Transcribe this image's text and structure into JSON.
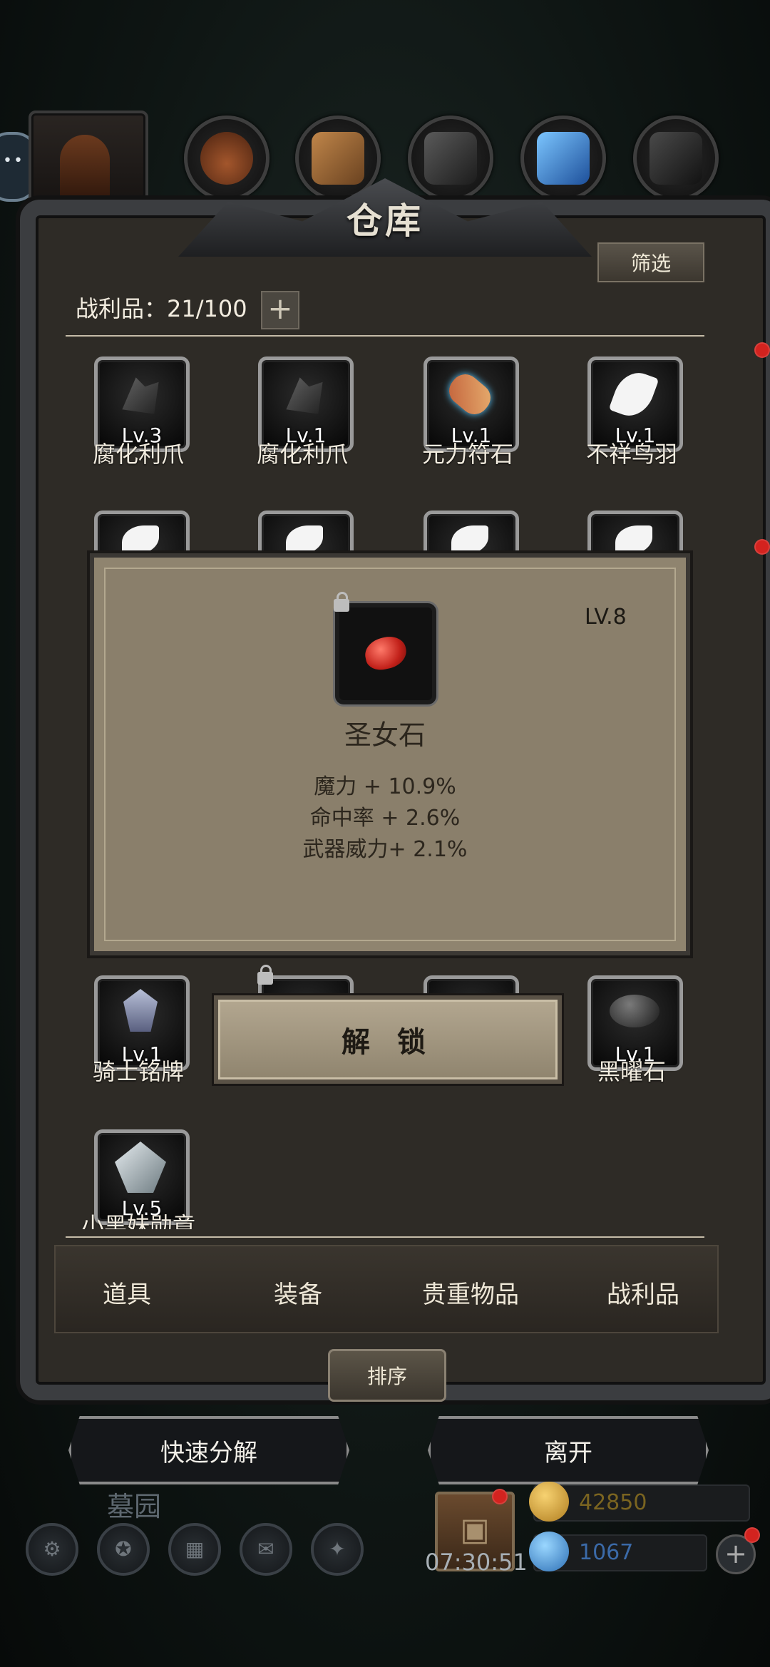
{
  "title": "仓库",
  "filter_label": "筛选",
  "capacity": {
    "label": "战利品：21/100",
    "add_symbol": "+"
  },
  "items_row1": [
    {
      "level": "Lv.3",
      "name": "腐化利爪",
      "icon": "claw-icon"
    },
    {
      "level": "Lv.1",
      "name": "腐化利爪",
      "icon": "claw-icon"
    },
    {
      "level": "Lv.1",
      "name": "元力符石",
      "icon": "rune-stone-icon"
    },
    {
      "level": "Lv.1",
      "name": "不祥鸟羽",
      "icon": "feather-icon"
    }
  ],
  "items_row_bottom": [
    {
      "level": "Lv.1",
      "name": "骑士铭牌",
      "icon": "knight-badge-icon"
    },
    {
      "level": "",
      "name": "",
      "icon": "locked-item-icon"
    },
    {
      "level": "",
      "name": "",
      "icon": "locked-item-icon"
    },
    {
      "level": "Lv.1",
      "name": "黑曜石",
      "icon": "obsidian-icon"
    }
  ],
  "items_last": [
    {
      "level": "Lv.5",
      "name": "小黑妹勋章",
      "icon": "crystal-medal-icon"
    }
  ],
  "detail": {
    "name": "圣女石",
    "level": "LV.8",
    "icon": "red-gem-icon",
    "stats": [
      "魔力 + 10.9%",
      "命中率 + 2.6%",
      "武器威力+ 2.1%"
    ],
    "unlock_label": "解 锁"
  },
  "tabs": [
    "道具",
    "装备",
    "贵重物品",
    "战利品"
  ],
  "active_tab": "战利品",
  "sort_label": "排序",
  "actions": {
    "quick_decompose": "快速分解",
    "leave": "离开"
  },
  "hud": {
    "location": "墓园",
    "timer": "07:30:51",
    "gold": "42850",
    "gems": "1067",
    "add_symbol": "+"
  },
  "colors": {
    "accent_red": "#d3231f",
    "gold_text": "#7a6420",
    "gem_text": "#3b6aa8",
    "panel": "#8a7f6b"
  }
}
